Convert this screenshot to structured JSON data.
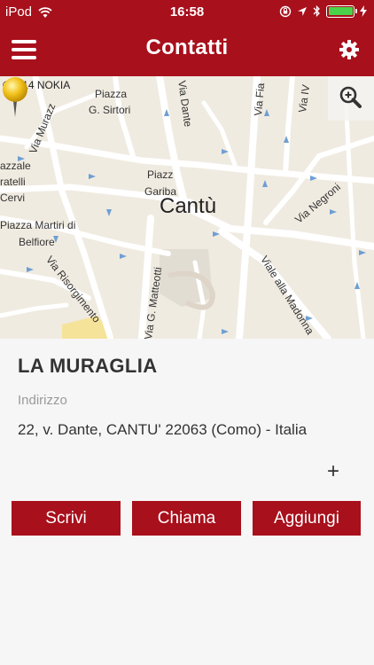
{
  "status_bar": {
    "carrier": "iPod",
    "time": "16:58"
  },
  "nav": {
    "title": "Contatti",
    "menu_icon": "hamburger-menu-icon",
    "settings_icon": "gear-icon"
  },
  "map": {
    "copyright": "©2014 NOKIA",
    "zoom_icon": "magnifier-plus-icon",
    "labels": {
      "piazza": "Piazza",
      "sirtori": "G. Sirtori",
      "dante": "Via Dante",
      "fi": "Via Fia",
      "iv": "Via IV",
      "murazzo": "Via Murazz",
      "azzale": "azzale",
      "ratelli": "ratelli",
      "cervi": "Cervi",
      "piazz2": "Piazz",
      "gariba": "Gariba",
      "cantu": "Cantù",
      "negroni": "Via Negroni",
      "martiri": "Piazza Martiri di",
      "belfiore": "Belfiore",
      "risorgimento": "Via Risorgimento",
      "matteotti": "Via G. Matteotti",
      "madonna": "Viale alla Madonna"
    }
  },
  "contact": {
    "name": "LA MURAGLIA",
    "address_label": "Indirizzo",
    "address": "22, v. Dante, CANTU' 22063 (Como) - Italia",
    "add_symbol": "+"
  },
  "actions": {
    "write": "Scrivi",
    "call": "Chiama",
    "add": "Aggiungi"
  },
  "colors": {
    "brand": "#a8101c",
    "map_bg": "#f0ebe1",
    "road": "#ffffff",
    "pin": "#f2c21b"
  }
}
